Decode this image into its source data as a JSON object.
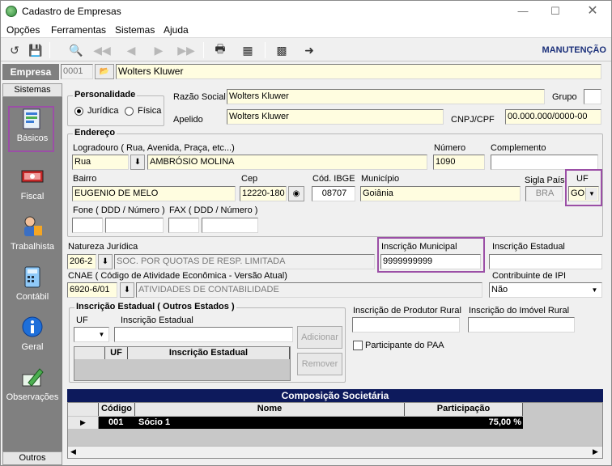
{
  "window": {
    "title": "Cadastro de Empresas"
  },
  "menu": [
    "Opções",
    "Ferramentas",
    "Sistemas",
    "Ajuda"
  ],
  "toolbar": {
    "mode": "MANUTENÇÃO"
  },
  "empresa": {
    "label": "Empresa",
    "code": "0001",
    "name": "Wolters Kluwer"
  },
  "sidebar": {
    "header": "Sistemas",
    "footer": "Outros",
    "items": [
      "Básicos",
      "Fiscal",
      "Trabalhista",
      "Contábil",
      "Geral",
      "Observações"
    ]
  },
  "personalidade": {
    "title": "Personalidade",
    "options": [
      "Jurídica",
      "Física"
    ],
    "selected": "Jurídica"
  },
  "basic": {
    "razao_label": "Razão Social",
    "razao_value": "Wolters Kluwer",
    "grupo_label": "Grupo",
    "apelido_label": "Apelido",
    "apelido_value": "Wolters Kluwer",
    "cnpj_label": "CNPJ/CPF",
    "cnpj_value": "00.000.000/0000-00"
  },
  "endereco": {
    "title": "Endereço",
    "logradouro_label": "Logradouro ( Rua, Avenida, Praça, etc...)",
    "tipo_value": "Rua",
    "logradouro_value": "AMBRÓSIO MOLINA",
    "numero_label": "Número",
    "numero_value": "1090",
    "complemento_label": "Complemento",
    "bairro_label": "Bairro",
    "bairro_value": "EUGENIO DE MELO",
    "cep_label": "Cep",
    "cep_value": "12220-180",
    "ibge_label": "Cód. IBGE",
    "ibge_value": "08707",
    "municipio_label": "Município",
    "municipio_value": "Goiânia",
    "sigla_label": "Sigla País",
    "sigla_value": "BRA",
    "uf_label": "UF",
    "uf_value": "GO",
    "fone_label": "Fone ( DDD / Número )",
    "fax_label": "FAX ( DDD / Número )"
  },
  "fiscal": {
    "natureza_label": "Natureza Jurídica",
    "natureza_code": "206-2",
    "natureza_desc": "SOC. POR QUOTAS DE RESP. LIMITADA",
    "im_label": "Inscrição Municipal",
    "im_value": "9999999999",
    "ie_label": "Inscrição Estadual",
    "cnae_label": "CNAE ( Código de Atividade Econômica - Versão Atual)",
    "cnae_code": "6920-6/01",
    "cnae_desc": "ATIVIDADES DE CONTABILIDADE",
    "ipi_label": "Contribuinte de IPI",
    "ipi_value": "Não"
  },
  "ie_outros": {
    "title": "Inscrição Estadual ( Outros Estados )",
    "uf_label": "UF",
    "ie_label": "Inscrição Estadual",
    "add_btn": "Adicionar",
    "remove_btn": "Remover",
    "col_uf": "UF",
    "col_ie": "Inscrição Estadual"
  },
  "rural": {
    "produtor_label": "Inscrição de Produtor Rural",
    "imovel_label": "Inscrição do Imóvel Rural",
    "paa_label": "Participante do PAA"
  },
  "composicao": {
    "title": "Composição Societária",
    "columns": [
      "Código",
      "Nome",
      "Participação"
    ],
    "rows": [
      {
        "codigo": "001",
        "nome": "Sócio 1",
        "participacao": "75,00 %"
      }
    ]
  }
}
